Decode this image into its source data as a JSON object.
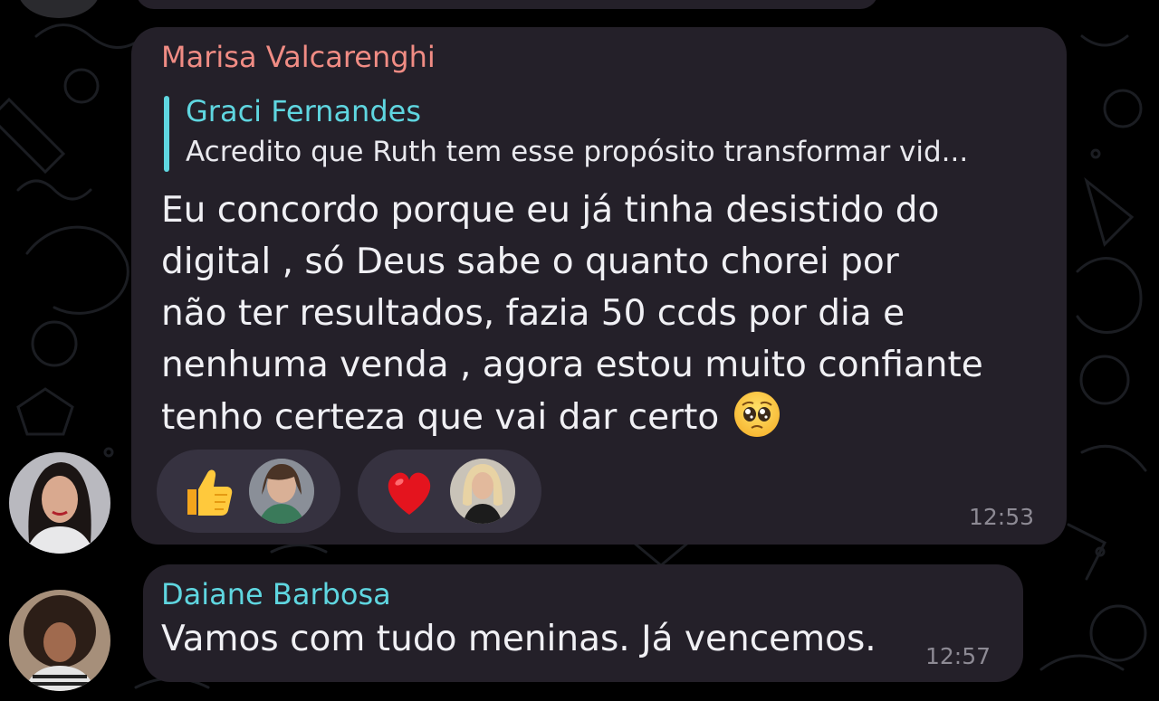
{
  "messages": [
    {
      "sender": "Marisa Valcarenghi",
      "sender_color": "#f08c84",
      "reply": {
        "name": "Graci Fernandes",
        "name_color": "#5fd6e0",
        "text": "Acredito que Ruth tem esse propósito transformar vid..."
      },
      "lines": [
        "Eu concordo porque eu já tinha desistido do",
        "digital , só Deus sabe o quanto chorei por",
        "não ter resultados, fazia 50 ccds por dia e",
        "nenhuma venda , agora estou muito confiante",
        "tenho certeza que vai dar certo"
      ],
      "trailing_emoji": "pleading-face-icon",
      "reactions": [
        {
          "emoji": "thumbs-up-icon"
        },
        {
          "emoji": "red-heart-icon"
        }
      ],
      "time": "12:53"
    },
    {
      "sender": "Daiane Barbosa",
      "sender_color": "#5fd6e0",
      "text": "Vamos com tudo meninas. Já vencemos.",
      "time": "12:57"
    }
  ],
  "colors": {
    "background": "#000000",
    "bubble": "#242029",
    "reaction_pill": "#363240",
    "time": "#8d8a94",
    "reply_bar": "#5fd6e0"
  }
}
